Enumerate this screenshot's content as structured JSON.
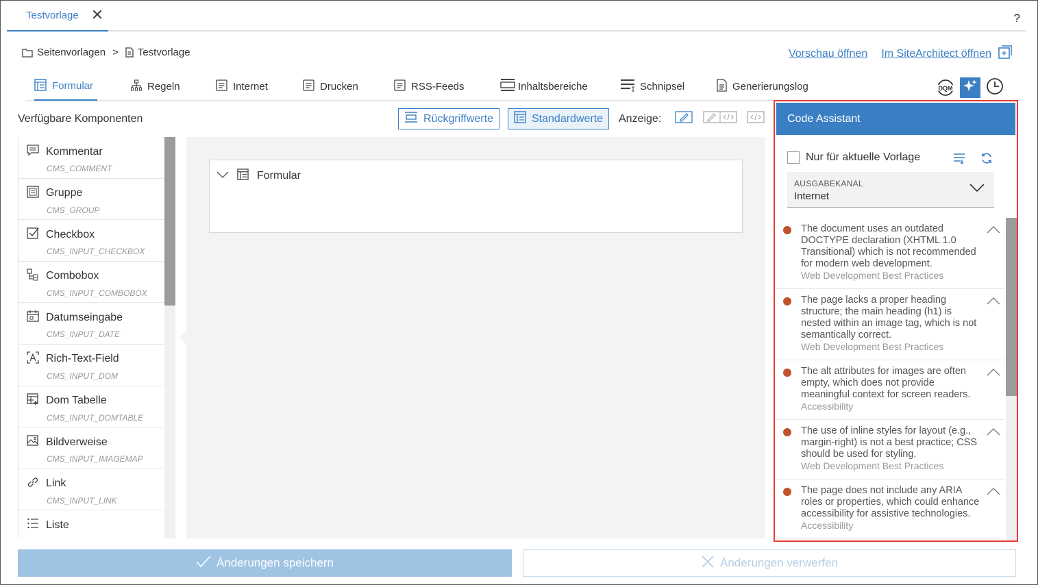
{
  "top_tab": {
    "label": "Testvorlage",
    "close": "✕"
  },
  "help": "?",
  "breadcrumb": {
    "parent": "Seitenvorlagen",
    "separator": ">",
    "current": "Testvorlage"
  },
  "links": {
    "preview": "Vorschau öffnen",
    "site_architect": "Im SiteArchitect öffnen"
  },
  "subtabs": [
    {
      "label": "Formular",
      "icon": "form-icon"
    },
    {
      "label": "Regeln",
      "icon": "rules-icon"
    },
    {
      "label": "Internet",
      "icon": "template-icon"
    },
    {
      "label": "Drucken",
      "icon": "template-icon"
    },
    {
      "label": "RSS-Feeds",
      "icon": "template-icon"
    },
    {
      "label": "Inhaltsbereiche",
      "icon": "content-areas-icon"
    },
    {
      "label": "Schnipsel",
      "icon": "snippet-icon"
    },
    {
      "label": "Generierungslog",
      "icon": "document-icon"
    }
  ],
  "tools": {
    "dqm": "DQM"
  },
  "toolbar": {
    "available_title": "Verfügbare Komponenten",
    "fallback_button": "Rückgriffwerte",
    "default_button": "Standardwerte",
    "display_label": "Anzeige:"
  },
  "components": [
    {
      "name": "Kommentar",
      "code": "CMS_COMMENT",
      "icon": "comment-icon"
    },
    {
      "name": "Gruppe",
      "code": "CMS_GROUP",
      "icon": "group-icon"
    },
    {
      "name": "Checkbox",
      "code": "CMS_INPUT_CHECKBOX",
      "icon": "checkbox-icon"
    },
    {
      "name": "Combobox",
      "code": "CMS_INPUT_COMBOBOX",
      "icon": "combobox-icon"
    },
    {
      "name": "Datumseingabe",
      "code": "CMS_INPUT_DATE",
      "icon": "calendar-icon"
    },
    {
      "name": "Rich-Text-Field",
      "code": "CMS_INPUT_DOM",
      "icon": "richtext-icon"
    },
    {
      "name": "Dom Tabelle",
      "code": "CMS_INPUT_DOMTABLE",
      "icon": "table-icon"
    },
    {
      "name": "Bildverweise",
      "code": "CMS_INPUT_IMAGEMAP",
      "icon": "image-icon"
    },
    {
      "name": "Link",
      "code": "CMS_INPUT_LINK",
      "icon": "link-icon"
    },
    {
      "name": "Liste",
      "code": "",
      "icon": "list-icon"
    }
  ],
  "form": {
    "title": "Formular"
  },
  "assistant": {
    "title": "Code Assistant",
    "only_current": "Nur für aktuelle Vorlage",
    "channel_caption": "AUSGABEKANAL",
    "channel_value": "Internet",
    "issues": [
      {
        "text": "The document uses an outdated DOCTYPE declaration (XHTML 1.0 Transitional) which is not recommended for modern web development.",
        "category": "Web Development Best Practices"
      },
      {
        "text": "The page lacks a proper heading structure; the main heading (h1) is nested within an image tag, which is not semantically correct.",
        "category": "Web Development Best Practices"
      },
      {
        "text": "The alt attributes for images are often empty, which does not provide meaningful context for screen readers.",
        "category": "Accessibility"
      },
      {
        "text": "The use of inline styles for layout (e.g., margin-right) is not a best practice; CSS should be used for styling.",
        "category": "Web Development Best Practices"
      },
      {
        "text": "The page does not include any ARIA roles or properties, which could enhance accessibility for assistive technologies.",
        "category": "Accessibility"
      }
    ],
    "severity_color": "#c0522e"
  },
  "footer": {
    "save": "Änderungen speichern",
    "discard": "Änderungen verwerfen"
  },
  "colors": {
    "accent": "#3a7fc4",
    "highlight_border": "#e53935"
  }
}
